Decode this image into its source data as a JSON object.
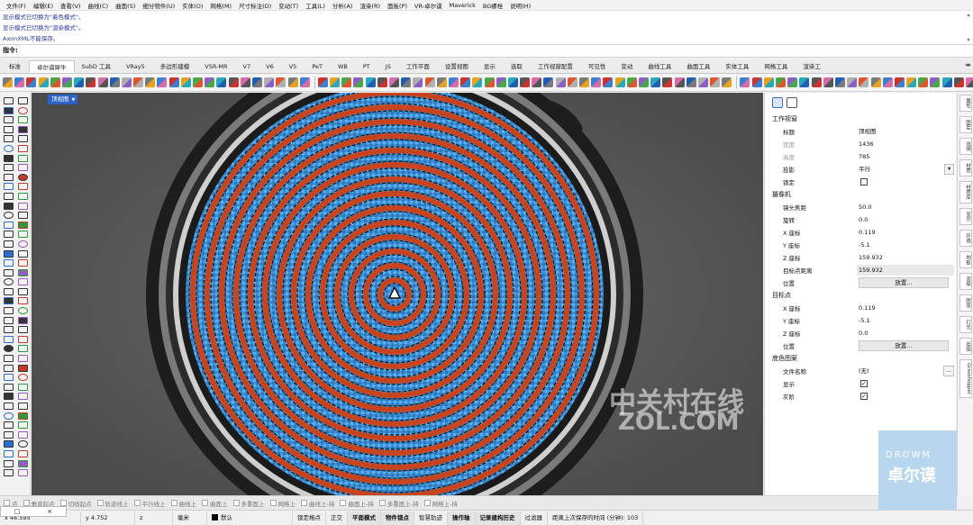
{
  "menu": [
    "文件(F)",
    "编辑(E)",
    "查看(V)",
    "曲线(C)",
    "曲面(S)",
    "细分物件(U)",
    "实体(O)",
    "网格(M)",
    "尺寸标注(D)",
    "变动(T)",
    "工具(L)",
    "分析(A)",
    "渲染(R)",
    "面板(P)",
    "VR-卓尔谟",
    "Maverick",
    "BG螺栓",
    "说明(H)"
  ],
  "history": [
    "显示模式已切换为\"着色模式\"。",
    "显示模式已切换为\"渲染模式\"。",
    "AxonXML不能保存。"
  ],
  "command": {
    "label": "指令:"
  },
  "tabs": [
    "标准",
    "卓尔谟犀牛",
    "SubD 工具",
    "VRay5",
    "多边形建模",
    "VSR-MR",
    "V7",
    "V6",
    "V5",
    "PeT",
    "WB",
    "PT",
    "JS",
    "工作平面",
    "设置视图",
    "显示",
    "选取",
    "工作视窗配置",
    "可见性",
    "变动",
    "曲线工具",
    "曲面工具",
    "实体工具",
    "网格工具",
    "渲染工"
  ],
  "active_tab": "卓尔谟犀牛",
  "viewport": {
    "label": "顶视图"
  },
  "panel": {
    "sections": {
      "viewport": "工作视窗",
      "camera": "摄像机",
      "target": "目标点",
      "wallpaper": "底色图案"
    },
    "viewport_rows": [
      {
        "label": "标题",
        "value": "顶视图"
      },
      {
        "label": "宽度",
        "value": "1436"
      },
      {
        "label": "高度",
        "value": "785"
      },
      {
        "label": "投影",
        "value": "平行"
      },
      {
        "label": "锁定",
        "value": ""
      }
    ],
    "camera_rows": [
      {
        "label": "镜头焦距",
        "value": "50.0"
      },
      {
        "label": "旋转",
        "value": "0.0"
      },
      {
        "label": "X 座标",
        "value": "0.119"
      },
      {
        "label": "Y 座标",
        "value": "-5.1"
      },
      {
        "label": "Z 座标",
        "value": "159.932"
      },
      {
        "label": "目标点距离",
        "value": "159.932"
      },
      {
        "label": "位置",
        "value": "放置..."
      }
    ],
    "target_rows": [
      {
        "label": "X 座标",
        "value": "0.119"
      },
      {
        "label": "Y 座标",
        "value": "-5.1"
      },
      {
        "label": "Z 座标",
        "value": "0.0"
      },
      {
        "label": "位置",
        "value": "放置..."
      }
    ],
    "wallpaper_rows": [
      {
        "label": "文件名称",
        "value": "(无)"
      },
      {
        "label": "显示",
        "value": ""
      },
      {
        "label": "灰阶",
        "value": ""
      }
    ]
  },
  "side_tabs": [
    "属性",
    "图层",
    "说明",
    "材质",
    "材质库",
    "显示",
    "环境",
    "地板",
    "渲染",
    "图块",
    "灯光",
    "出图",
    "Grasshopper"
  ],
  "osnaps": [
    "点",
    "垂直起点",
    "切线起点",
    "轨迹线上",
    "平行线上",
    "曲线上",
    "曲面上",
    "多重面上",
    "网格上",
    "曲线上-持",
    "曲面上-持",
    "多重面上-持",
    "网格上-持"
  ],
  "status": {
    "x": "x 48.595",
    "y": "y 4.752",
    "z": "z",
    "unit": "毫米",
    "layer": "默认",
    "items": [
      "锁定格点",
      "正交",
      "平面模式",
      "物件锁点",
      "智慧轨迹",
      "操作轴",
      "记录建构历史",
      "过滤器"
    ],
    "bold_items": [
      "平面模式",
      "物件锁点",
      "操作轴",
      "记录建构历史"
    ],
    "save_info": "距离上次保存的时间 (分钟): 103"
  },
  "mini_window": {
    "restore": "□",
    "close": "×"
  },
  "watermarks": {
    "zol_cn": "中关村在线",
    "zol_en": "ZOL.COM"
  },
  "brand": {
    "top": "DROWM",
    "bottom": "卓尔谟"
  },
  "colors": {
    "red_ring": "#c8441f",
    "blue_ring": "#3f9be0",
    "viewport_bg": "#5b5b5b",
    "label_bg": "#2a62c7"
  }
}
